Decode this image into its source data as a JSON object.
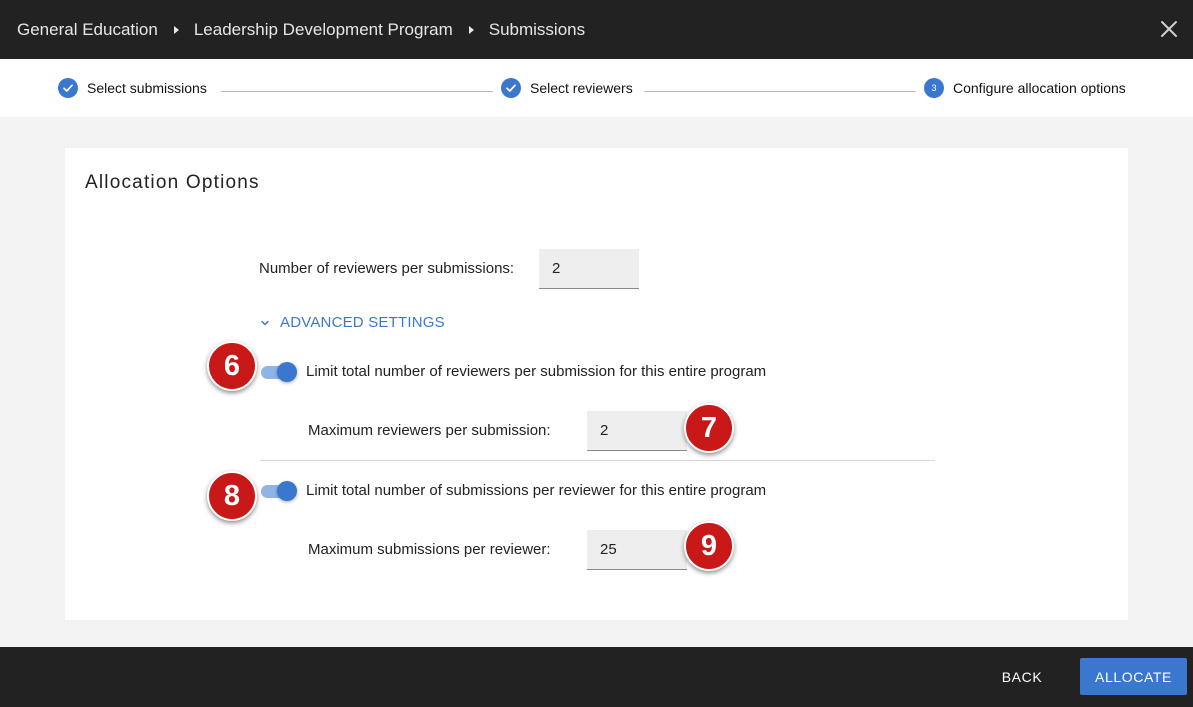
{
  "header": {
    "breadcrumb": [
      "General Education",
      "Leadership Development Program",
      "Submissions"
    ]
  },
  "stepper": {
    "steps": [
      {
        "label": "Select submissions",
        "state": "completed"
      },
      {
        "label": "Select reviewers",
        "state": "completed"
      },
      {
        "label": "Configure allocation options",
        "state": "active",
        "number": "3"
      }
    ]
  },
  "card": {
    "title": "Allocation Options",
    "reviewers_per_submission_label": "Number of reviewers per submissions:",
    "reviewers_per_submission_value": "2",
    "advanced_settings_label": "ADVANCED SETTINGS",
    "limit_reviewers": {
      "label": "Limit total number of reviewers per submission for this entire program",
      "enabled": true,
      "max_label": "Maximum reviewers per submission:",
      "max_value": "2"
    },
    "limit_submissions": {
      "label": "Limit total number of submissions per reviewer for this entire program",
      "enabled": true,
      "max_label": "Maximum submissions per reviewer:",
      "max_value": "25"
    }
  },
  "callouts": [
    "6",
    "7",
    "8",
    "9"
  ],
  "footer": {
    "back_label": "BACK",
    "allocate_label": "ALLOCATE"
  },
  "colors": {
    "accent": "#3a78d0",
    "topbar": "#222222",
    "callout": "#c81818"
  }
}
